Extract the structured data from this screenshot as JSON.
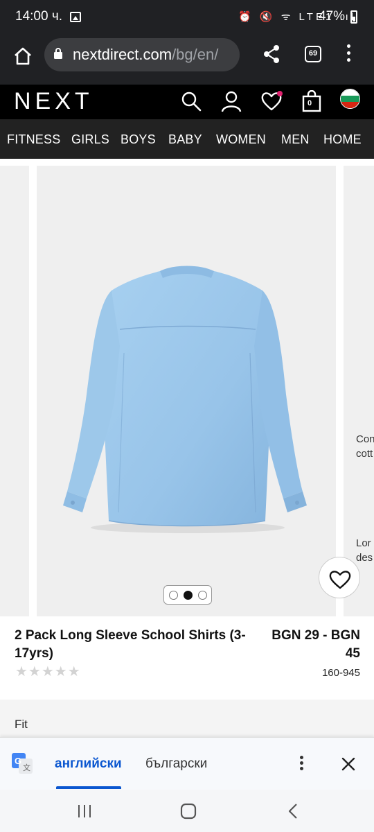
{
  "status_bar": {
    "time": "14:00 ч.",
    "network_icons": "⏰ 🔇 ᯤ LTE1 .ıl",
    "battery": "47%"
  },
  "browser": {
    "url_host": "nextdirect.com",
    "url_path": "/bg/en/",
    "tab_count": "69"
  },
  "header": {
    "logo": "NEXT",
    "bag_count": "0"
  },
  "nav": {
    "items": [
      "FITNESS",
      "GIRLS",
      "BOYS",
      "BABY",
      "WOMEN",
      "MEN",
      "HOME"
    ]
  },
  "gallery": {
    "right_panel_lines": [
      "Con",
      "cott",
      "Lor",
      "des"
    ],
    "image_count": 3,
    "active_image": 2
  },
  "product": {
    "title": "2 Pack Long Sleeve School Shirts (3-17yrs)",
    "price": "BGN 29 - BGN 45",
    "code": "160-945",
    "rating_stars": 0
  },
  "fit": {
    "label": "Fit"
  },
  "translate": {
    "source_lang": "английски",
    "target_lang": "български"
  },
  "colors": {
    "shirt_blue": "#9cc7ea",
    "translate_blue": "#0b57d0",
    "heart_dot": "#e0226f"
  }
}
